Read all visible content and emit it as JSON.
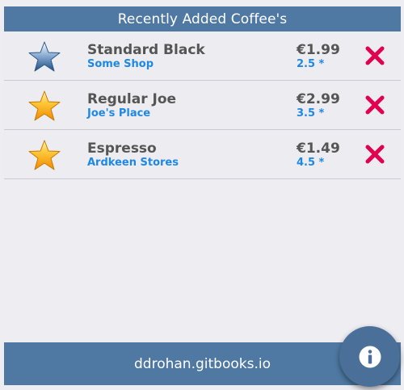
{
  "header": {
    "title": "Recently Added Coffee's"
  },
  "coffees": [
    {
      "name": "Standard Black",
      "shop": "Some Shop",
      "price": "€1.99",
      "rating": "2.5 *",
      "star_icon": "star-blue-icon",
      "delete_icon": "close-icon"
    },
    {
      "name": "Regular Joe",
      "shop": "Joe's Place",
      "price": "€2.99",
      "rating": "3.5 *",
      "star_icon": "star-gold-icon",
      "delete_icon": "close-icon"
    },
    {
      "name": "Espresso",
      "shop": "Ardkeen Stores",
      "price": "€1.49",
      "rating": "4.5 *",
      "star_icon": "star-gold-icon",
      "delete_icon": "close-icon"
    }
  ],
  "footer": {
    "text": "ddrohan.gitbooks.io"
  },
  "fab": {
    "icon": "info-icon"
  },
  "colors": {
    "bar": "#4f79a3",
    "background": "#ededf2",
    "name_text": "#555555",
    "accent_text": "#1e88e5",
    "delete": "#e3004f",
    "star_gold": "#f5a623",
    "star_blue": "#3b6fa8"
  }
}
